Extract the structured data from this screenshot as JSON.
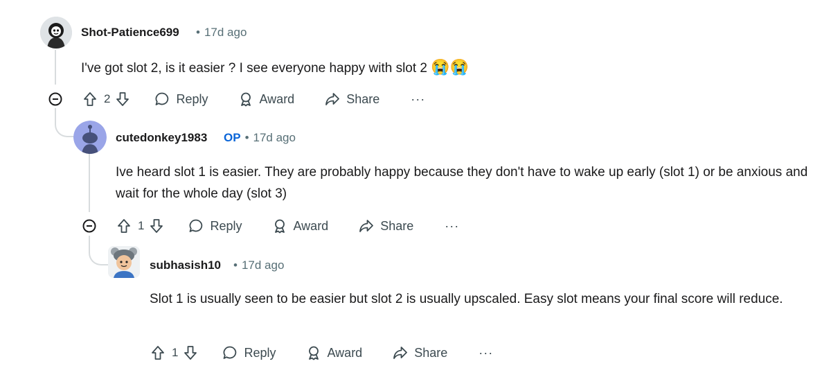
{
  "comments": [
    {
      "username": "Shot-Patience699",
      "op": "",
      "time": "17d ago",
      "body": "I've got slot 2, is it easier ? I see everyone happy with slot 2",
      "emoji": "😭😭",
      "votes": "2",
      "reply_label": "Reply",
      "award_label": "Award",
      "share_label": "Share",
      "more_label": "···"
    },
    {
      "username": "cutedonkey1983",
      "op": "OP",
      "time": "17d ago",
      "body": "Ive heard slot 1 is easier. They are probably happy because they don't have to wake up early (slot 1) or be anxious and wait for the whole day (slot 3)",
      "votes": "1",
      "reply_label": "Reply",
      "award_label": "Award",
      "share_label": "Share",
      "more_label": "···"
    },
    {
      "username": "subhasish10",
      "op": "",
      "time": "17d ago",
      "body": "Slot 1 is usually seen to be easier but slot 2 is usually upscaled. Easy slot means your final score will reduce.",
      "votes": "1",
      "reply_label": "Reply",
      "award_label": "Award",
      "share_label": "Share",
      "more_label": "···"
    }
  ],
  "icons": {
    "collapse": "minus-circle-icon",
    "upvote": "arrow-up-icon",
    "downvote": "arrow-down-icon",
    "reply": "speech-bubble-icon",
    "award": "award-icon",
    "share": "share-arrow-icon",
    "more": "ellipsis-icon"
  },
  "colors": {
    "text": "#1a1a1b",
    "meta": "#576f76",
    "op": "#0a65d8",
    "thread": "#d8dcde",
    "action": "#3c4a50"
  }
}
